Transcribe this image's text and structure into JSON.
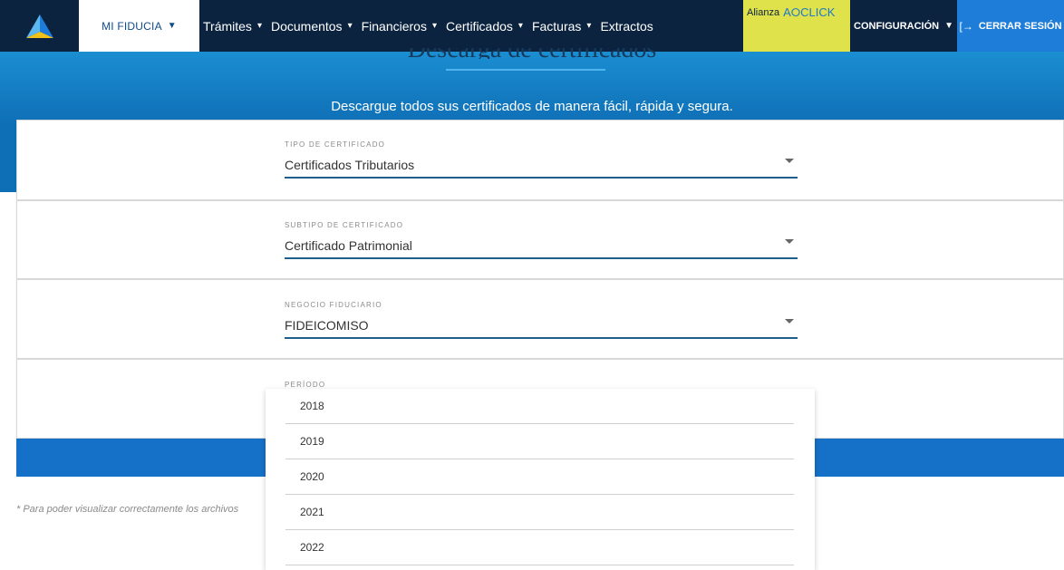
{
  "nav": {
    "mi_fiducia": "MI FIDUCIA",
    "menu": [
      "Trámites",
      "Documentos",
      "Financieros",
      "Certificados",
      "Facturas",
      "Extractos"
    ],
    "alianza_label": "Alianza",
    "alianza_click": "A⭘CLICK",
    "config_label": "CONFIGURACIÓN",
    "logout_label": "CERRAR SESIÓN",
    "colors": {
      "navy": "#0c2340",
      "accent_yellow": "#dfe24a",
      "logout_blue": "#1e7dd8"
    }
  },
  "hero": {
    "title": "Descarga de certificados",
    "subtitle": "Descargue todos sus certificados de manera fácil, rápida y segura."
  },
  "form": {
    "tipo": {
      "label": "TIPO DE CERTIFICADO",
      "value": "Certificados Tributarios"
    },
    "subtipo": {
      "label": "SUBTIPO DE CERTIFICADO",
      "value": "Certificado Patrimonial"
    },
    "negocio": {
      "label": "NEGOCIO FIDUCIARIO",
      "value": "FIDEICOMISO"
    },
    "periodo": {
      "label": "PERÍODO",
      "options": [
        "2018",
        "2019",
        "2020",
        "2021",
        "2022"
      ]
    }
  },
  "note": "* Para poder visualizar correctamente los archivos"
}
